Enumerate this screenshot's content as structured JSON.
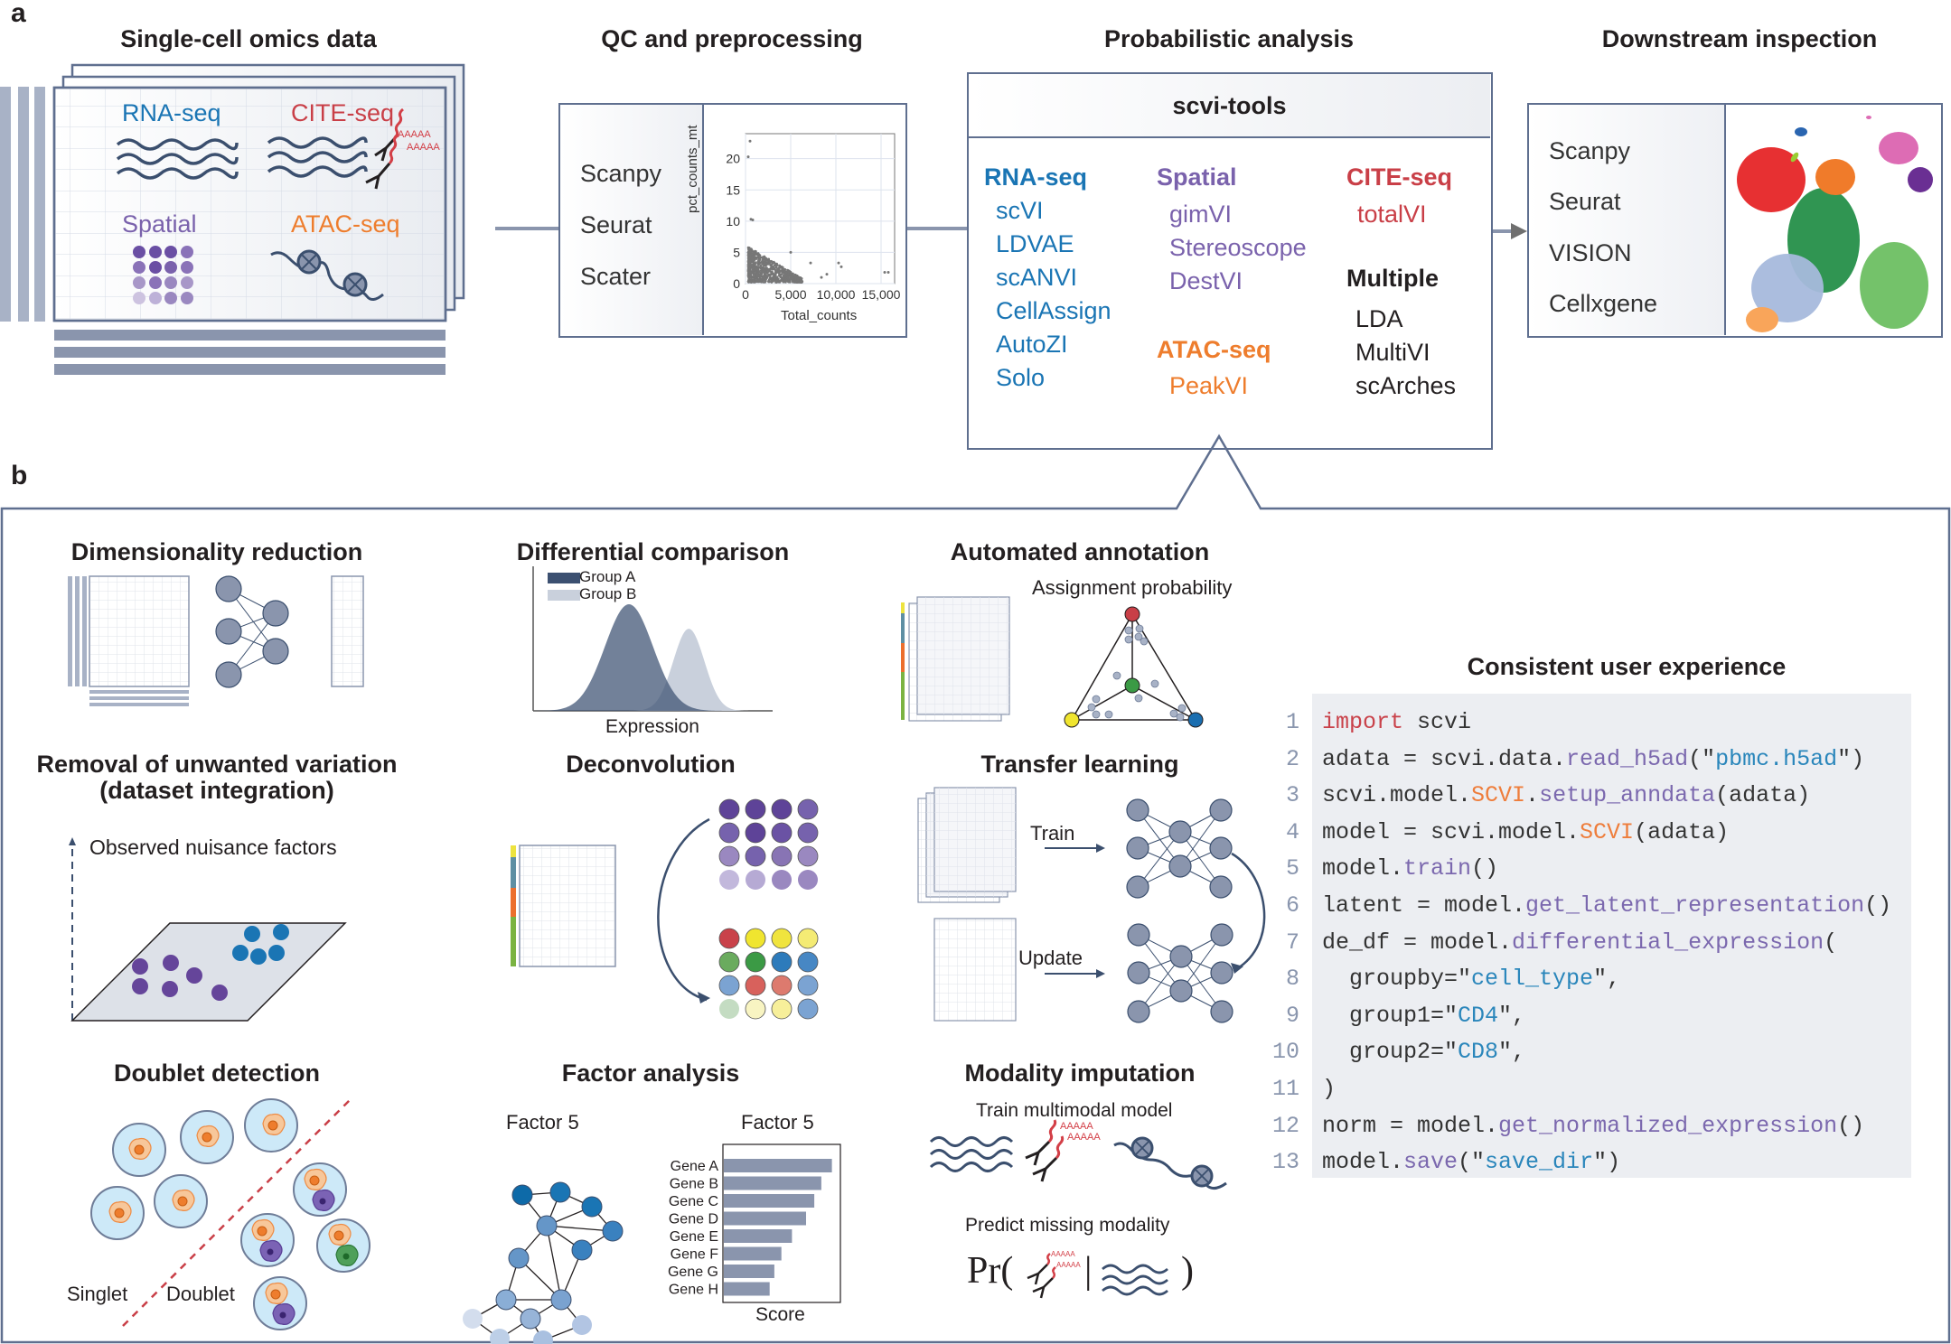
{
  "panel_a": {
    "letter": "a",
    "stages": [
      {
        "title": "Single-cell omics data"
      },
      {
        "title": "QC and preprocessing"
      },
      {
        "title": "Probabilistic analysis"
      },
      {
        "title": "Downstream inspection"
      }
    ],
    "omics": {
      "rna": "RNA-seq",
      "cite": "CITE-seq",
      "spatial": "Spatial",
      "atac": "ATAC-seq",
      "polyA": "AAAAA"
    },
    "qc": {
      "tools": [
        "Scanpy",
        "Seurat",
        "Scater"
      ],
      "plot": {
        "xlabel": "Total_counts",
        "ylabel": "pct_counts_mt",
        "xticks": [
          "0",
          "5,000",
          "10,000",
          "15,000"
        ],
        "yticks": [
          "0",
          "5",
          "10",
          "15",
          "20"
        ]
      }
    },
    "scvi": {
      "title": "scvi-tools",
      "groups": [
        {
          "name": "RNA-seq",
          "color": "#1a75b4",
          "models": [
            "scVI",
            "LDVAE",
            "scANVI",
            "CellAssign",
            "AutoZI",
            "Solo"
          ]
        },
        {
          "name": "Spatial",
          "color": "#7a62ac",
          "models": [
            "gimVI",
            "Stereoscope",
            "DestVI"
          ]
        },
        {
          "name": "ATAC-seq",
          "color": "#ee7d2d",
          "models": [
            "PeakVI"
          ]
        },
        {
          "name": "CITE-seq",
          "color": "#c93f47",
          "models": [
            "totalVI"
          ]
        },
        {
          "name": "Multiple",
          "color": "#231f20",
          "models": [
            "LDA",
            "MultiVI",
            "scArches"
          ]
        }
      ]
    },
    "downstream": {
      "tools": [
        "Scanpy",
        "Seurat",
        "VISION",
        "Cellxgene"
      ]
    }
  },
  "panel_b": {
    "letter": "b",
    "sections": {
      "dimred": {
        "title": "Dimensionality reduction"
      },
      "diffcomp": {
        "title": "Differential comparison",
        "legend": [
          "Group A",
          "Group B"
        ],
        "xlabel": "Expression"
      },
      "annotation": {
        "title": "Automated annotation",
        "subtitle": "Assignment probability"
      },
      "integration": {
        "title_line1": "Removal of unwanted variation",
        "title_line2": "(dataset integration)",
        "axis_label": "Observed nuisance factors"
      },
      "deconv": {
        "title": "Deconvolution"
      },
      "transfer": {
        "title": "Transfer learning",
        "train": "Train",
        "update": "Update"
      },
      "doublet": {
        "title": "Doublet detection",
        "singlet": "Singlet",
        "doublet": "Doublet"
      },
      "factor": {
        "title": "Factor analysis",
        "network_label": "Factor 5",
        "bar_title": "Factor 5",
        "xlabel": "Score"
      },
      "imputation": {
        "title": "Modality imputation",
        "train_label": "Train multimodal model",
        "predict_label": "Predict missing modality",
        "formula_prefix": "Pr(",
        "formula_bar": "|",
        "formula_suffix": ")"
      },
      "ux": {
        "title": "Consistent user experience"
      }
    },
    "code": [
      [
        [
          "kw",
          "import"
        ],
        [
          "plain",
          " scvi"
        ]
      ],
      [
        [
          "plain",
          "adata = scvi.data."
        ],
        [
          "fn",
          "read_h5ad"
        ],
        [
          "plain",
          "(\""
        ],
        [
          "str",
          "pbmc.h5ad"
        ],
        [
          "plain",
          "\")"
        ]
      ],
      [
        [
          "plain",
          "scvi.model."
        ],
        [
          "cls",
          "SCVI"
        ],
        [
          "plain",
          "."
        ],
        [
          "fn",
          "setup_anndata"
        ],
        [
          "plain",
          "(adata)"
        ]
      ],
      [
        [
          "plain",
          "model = scvi.model."
        ],
        [
          "cls",
          "SCVI"
        ],
        [
          "plain",
          "(adata)"
        ]
      ],
      [
        [
          "plain",
          "model."
        ],
        [
          "fn",
          "train"
        ],
        [
          "plain",
          "()"
        ]
      ],
      [
        [
          "plain",
          "latent = model."
        ],
        [
          "fn",
          "get_latent_representation"
        ],
        [
          "plain",
          "()"
        ]
      ],
      [
        [
          "plain",
          "de_df = model."
        ],
        [
          "fn",
          "differential_expression"
        ],
        [
          "plain",
          "("
        ]
      ],
      [
        [
          "plain",
          "  groupby=\""
        ],
        [
          "str",
          "cell_type"
        ],
        [
          "plain",
          "\","
        ]
      ],
      [
        [
          "plain",
          "  group1=\""
        ],
        [
          "str",
          "CD4"
        ],
        [
          "plain",
          "\","
        ]
      ],
      [
        [
          "plain",
          "  group2=\""
        ],
        [
          "str",
          "CD8"
        ],
        [
          "plain",
          "\","
        ]
      ],
      [
        [
          "plain",
          ")"
        ]
      ],
      [
        [
          "plain",
          "norm = model."
        ],
        [
          "fn",
          "get_normalized_expression"
        ],
        [
          "plain",
          "()"
        ]
      ],
      [
        [
          "plain",
          "model."
        ],
        [
          "fn",
          "save"
        ],
        [
          "plain",
          "(\""
        ],
        [
          "str",
          "save_dir"
        ],
        [
          "plain",
          "\")"
        ]
      ]
    ]
  },
  "chart_data": [
    {
      "type": "scatter",
      "title": "",
      "xlabel": "Total_counts",
      "ylabel": "pct_counts_mt",
      "xlim": [
        0,
        16500
      ],
      "ylim": [
        0,
        24
      ],
      "xticks": [
        0,
        5000,
        10000,
        15000
      ],
      "yticks": [
        0,
        5,
        10,
        15,
        20
      ],
      "grid": true,
      "points_note": "dense cloud 300-6000 counts at 0-7%",
      "outliers": [
        [
          500,
          22.8
        ],
        [
          300,
          20.3
        ],
        [
          600,
          10.3
        ],
        [
          800,
          10.2
        ],
        [
          10300,
          3.3
        ],
        [
          10600,
          2.7
        ],
        [
          15400,
          1.8
        ],
        [
          15800,
          1.8
        ],
        [
          7200,
          3.3
        ],
        [
          8400,
          1.0
        ],
        [
          9000,
          1.5
        ],
        [
          5000,
          5.0
        ]
      ]
    },
    {
      "type": "bar",
      "orientation": "horizontal",
      "title": "Factor 5",
      "xlabel": "Score",
      "categories": [
        "Gene A",
        "Gene B",
        "Gene C",
        "Gene D",
        "Gene E",
        "Gene F",
        "Gene G",
        "Gene H"
      ],
      "values": [
        0.92,
        0.83,
        0.77,
        0.7,
        0.58,
        0.49,
        0.43,
        0.39
      ],
      "xlim": [
        0,
        1
      ]
    },
    {
      "type": "area",
      "title": "Differential comparison",
      "xlabel": "Expression",
      "series": [
        {
          "name": "Group A",
          "mean": 0.4,
          "sd": 0.1,
          "peak": 1.0,
          "color": "#3c5071"
        },
        {
          "name": "Group B",
          "mean": 0.65,
          "sd": 0.065,
          "peak": 0.77,
          "color": "#c9d0dc"
        }
      ]
    }
  ]
}
